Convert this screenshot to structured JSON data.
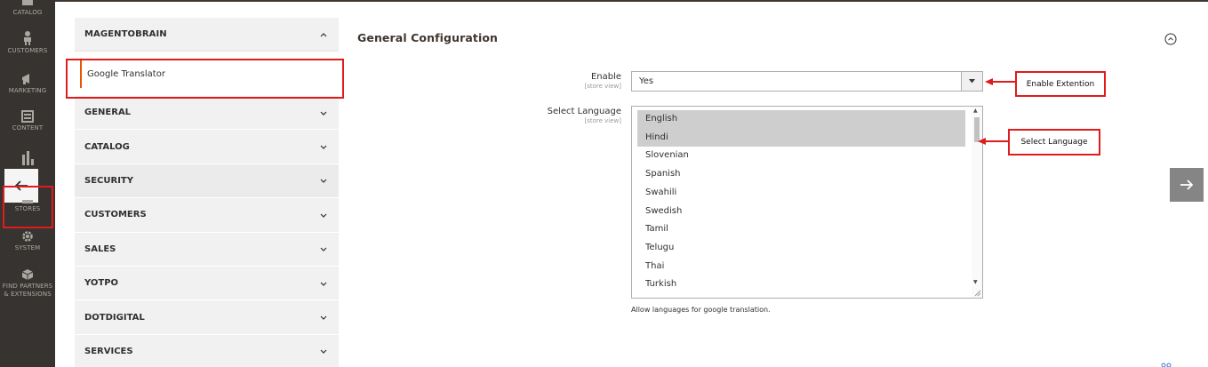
{
  "nav": {
    "catalog": "CATALOG",
    "customers": "CUSTOMERS",
    "marketing": "MARKETING",
    "content": "CONTENT",
    "stores": "STORES",
    "system": "SYSTEM",
    "partners_line1": "FIND PARTNERS",
    "partners_line2": "& EXTENSIONS"
  },
  "tabs": {
    "group_title": "MAGENTOBRAIN",
    "active_item": "Google Translator",
    "sections": [
      "GENERAL",
      "CATALOG",
      "SECURITY",
      "CUSTOMERS",
      "SALES",
      "YOTPO",
      "DOTDIGITAL",
      "SERVICES"
    ]
  },
  "config": {
    "section_title": "General Configuration",
    "enable": {
      "label": "Enable",
      "scope": "[store view]",
      "value": "Yes"
    },
    "language": {
      "label": "Select Language",
      "scope": "[store view]",
      "options": [
        {
          "label": "English",
          "selected": true
        },
        {
          "label": "Hindi",
          "selected": true
        },
        {
          "label": "Slovenian",
          "selected": false
        },
        {
          "label": "Spanish",
          "selected": false
        },
        {
          "label": "Swahili",
          "selected": false
        },
        {
          "label": "Swedish",
          "selected": false
        },
        {
          "label": "Tamil",
          "selected": false
        },
        {
          "label": "Telugu",
          "selected": false
        },
        {
          "label": "Thai",
          "selected": false
        },
        {
          "label": "Turkish",
          "selected": false
        }
      ],
      "note": "Allow languages for google translation."
    }
  },
  "annotations": {
    "enable": "Enable Extention",
    "language": "Select Language"
  },
  "colors": {
    "nav_bg": "#373330",
    "accent": "#eb5202",
    "highlight_red": "#e01b1b"
  }
}
